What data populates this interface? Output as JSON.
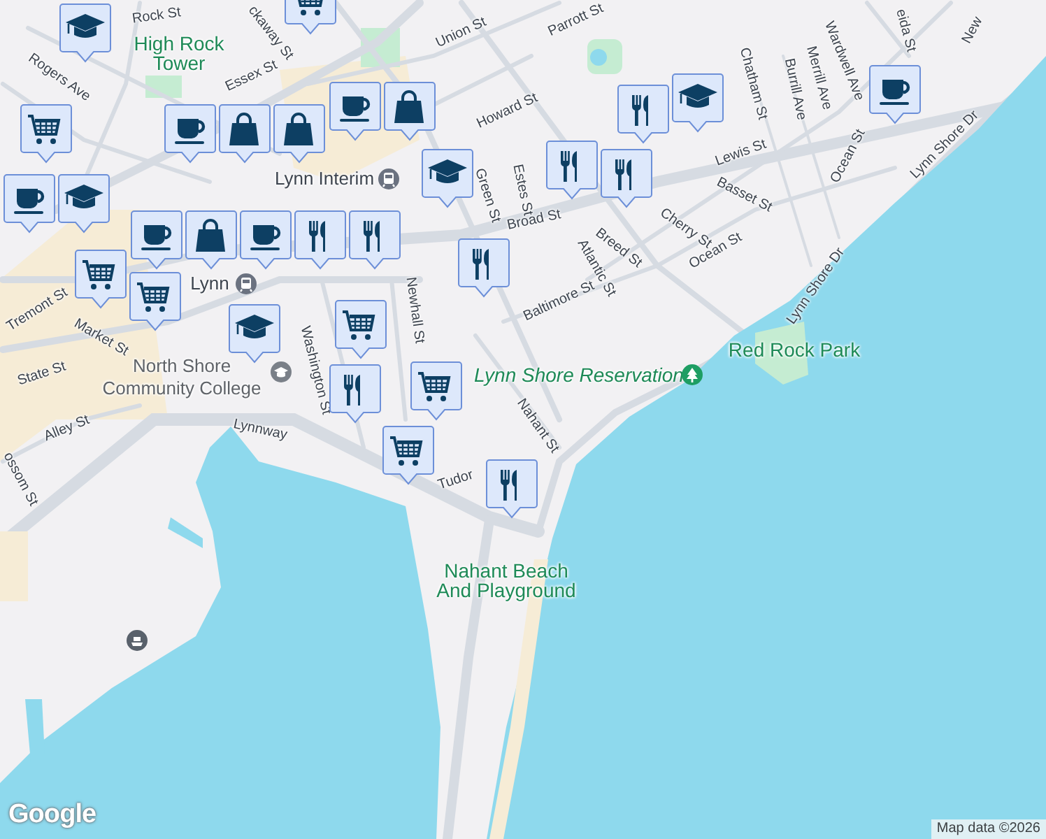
{
  "map": {
    "labels": [
      {
        "text": "Rock St",
        "kind": "street"
      },
      {
        "text": "ckaway St",
        "kind": "street"
      },
      {
        "text": "High Rock Tower",
        "kind": "park"
      },
      {
        "text": "Union St",
        "kind": "street"
      },
      {
        "text": "Parrott St",
        "kind": "street"
      },
      {
        "text": "Essex St",
        "kind": "street"
      },
      {
        "text": "Rogers Ave",
        "kind": "street"
      },
      {
        "text": "Howard St",
        "kind": "street"
      },
      {
        "text": "Green St",
        "kind": "street"
      },
      {
        "text": "Estes St",
        "kind": "street"
      },
      {
        "text": "Chatham St",
        "kind": "street"
      },
      {
        "text": "Lewis St",
        "kind": "street"
      },
      {
        "text": "Cherry St",
        "kind": "street"
      },
      {
        "text": "Basset St",
        "kind": "street"
      },
      {
        "text": "Breed St",
        "kind": "street"
      },
      {
        "text": "Atlantic St",
        "kind": "street"
      },
      {
        "text": "Ocean St",
        "kind": "street"
      },
      {
        "text": "Ocean St",
        "kind": "street"
      },
      {
        "text": "Baltimore St",
        "kind": "street"
      },
      {
        "text": "Lynn Shore Dr",
        "kind": "street"
      },
      {
        "text": "Lynn Shore Dr",
        "kind": "street"
      },
      {
        "text": "Burrill Ave",
        "kind": "street"
      },
      {
        "text": "Merrill Ave",
        "kind": "street"
      },
      {
        "text": "Wardwell Ave",
        "kind": "street"
      },
      {
        "text": "eida St",
        "kind": "street"
      },
      {
        "text": "New",
        "kind": "street"
      },
      {
        "text": "Red Rock Park",
        "kind": "park"
      },
      {
        "text": "Lynn Shore Reservation",
        "kind": "park"
      },
      {
        "text": "Broad St",
        "kind": "street"
      },
      {
        "text": "Lynn",
        "kind": "transit"
      },
      {
        "text": "Lynn Interim",
        "kind": "transit"
      },
      {
        "text": "Newhall St",
        "kind": "street"
      },
      {
        "text": "Washington St",
        "kind": "street"
      },
      {
        "text": "Market St",
        "kind": "street"
      },
      {
        "text": "State St",
        "kind": "street"
      },
      {
        "text": "Tremont St",
        "kind": "street"
      },
      {
        "text": "North Shore Community College",
        "kind": "poi"
      },
      {
        "text": "Lynnway",
        "kind": "street"
      },
      {
        "text": "Alley St",
        "kind": "street"
      },
      {
        "text": "ossom St",
        "kind": "street"
      },
      {
        "text": "Nahant St",
        "kind": "street"
      },
      {
        "text": "Tudor",
        "kind": "street"
      },
      {
        "text": "Nahant Beach And Playground",
        "kind": "park"
      }
    ],
    "pins": [
      {
        "kind": "school"
      },
      {
        "kind": "grocery"
      },
      {
        "kind": "grocery"
      },
      {
        "kind": "cafe"
      },
      {
        "kind": "school"
      },
      {
        "kind": "shopping"
      },
      {
        "kind": "cafe"
      },
      {
        "kind": "shopping"
      },
      {
        "kind": "shopping"
      },
      {
        "kind": "cafe"
      },
      {
        "kind": "cafe"
      },
      {
        "kind": "school"
      },
      {
        "kind": "cafe"
      },
      {
        "kind": "shopping"
      },
      {
        "kind": "restaurant"
      },
      {
        "kind": "restaurant"
      },
      {
        "kind": "restaurant"
      },
      {
        "kind": "grocery"
      },
      {
        "kind": "grocery"
      },
      {
        "kind": "school"
      },
      {
        "kind": "grocery"
      },
      {
        "kind": "restaurant"
      },
      {
        "kind": "grocery"
      },
      {
        "kind": "grocery"
      },
      {
        "kind": "restaurant"
      },
      {
        "kind": "restaurant"
      },
      {
        "kind": "restaurant"
      },
      {
        "kind": "school"
      },
      {
        "kind": "restaurant"
      },
      {
        "kind": "cafe"
      }
    ]
  },
  "logo": "Google",
  "attribution": "Map data ©2026"
}
